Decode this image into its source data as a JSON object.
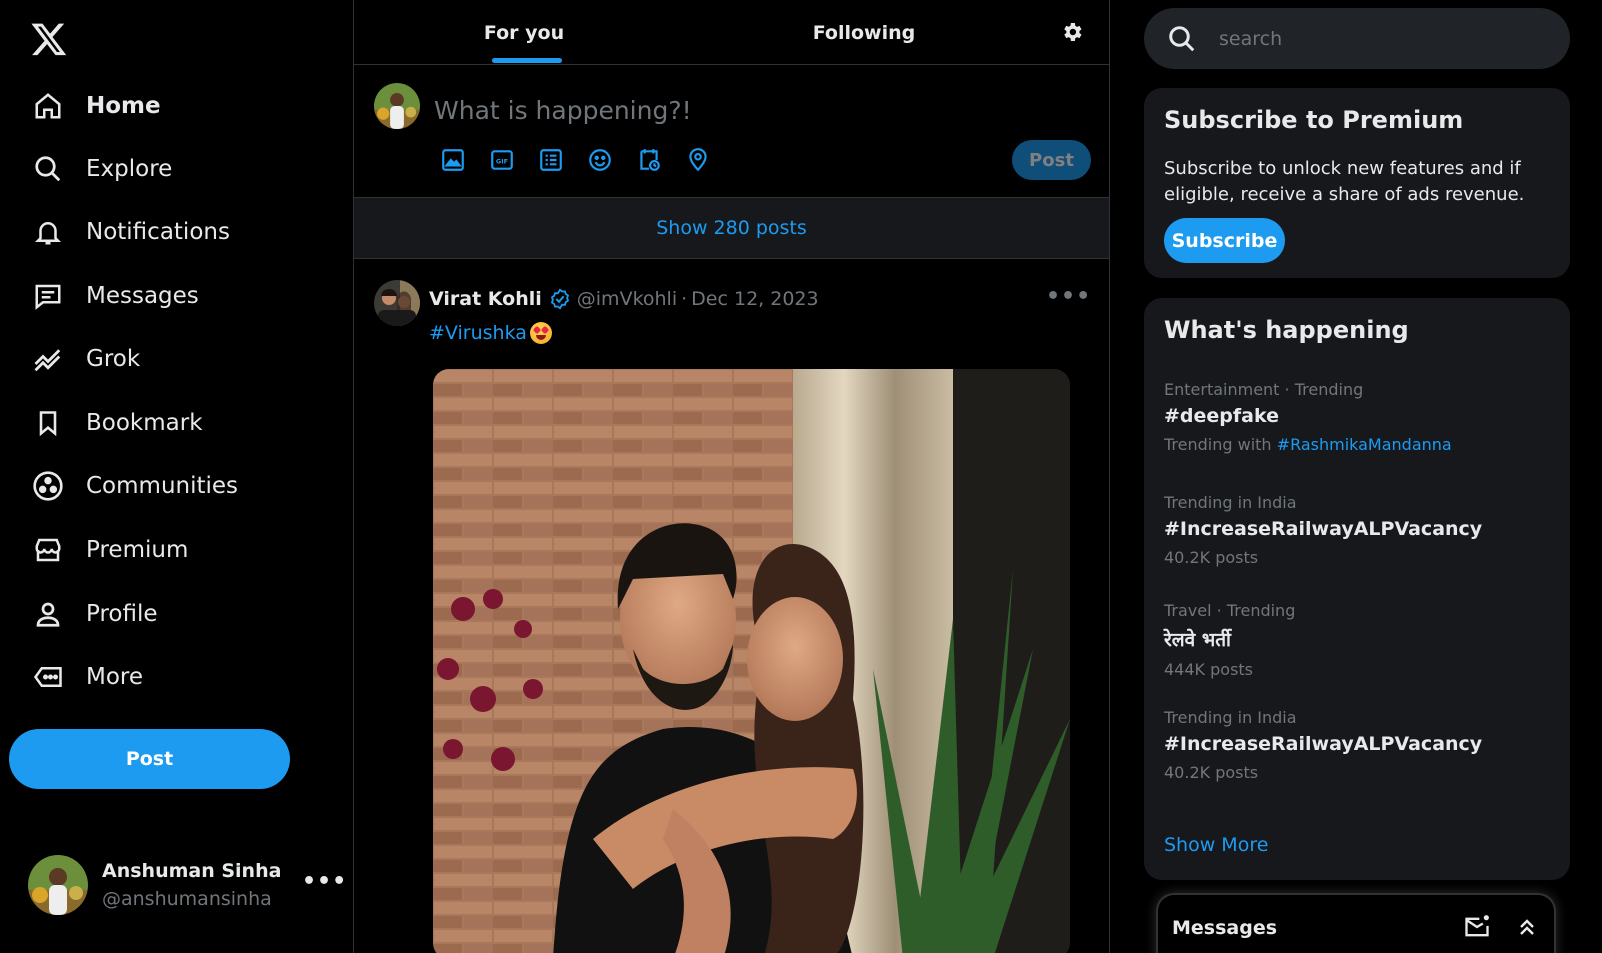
{
  "sidebar": {
    "logo_icon": "x-logo-icon",
    "items": [
      {
        "label": "Home",
        "icon": "home-icon",
        "active": true
      },
      {
        "label": "Explore",
        "icon": "search-icon"
      },
      {
        "label": "Notifications",
        "icon": "bell-icon"
      },
      {
        "label": "Messages",
        "icon": "message-icon"
      },
      {
        "label": "Grok",
        "icon": "grok-icon"
      },
      {
        "label": "Bookmark",
        "icon": "bookmark-icon"
      },
      {
        "label": "Communities",
        "icon": "communities-icon"
      },
      {
        "label": "Premium",
        "icon": "premium-icon"
      },
      {
        "label": "Profile",
        "icon": "profile-icon"
      },
      {
        "label": "More",
        "icon": "more-icon"
      }
    ],
    "post_label": "Post",
    "account": {
      "name": "Anshuman Sinha",
      "handle": "@anshumansinha",
      "more": "•••"
    }
  },
  "feed": {
    "tabs": [
      {
        "label": "For you",
        "active": true
      },
      {
        "label": "Following"
      }
    ],
    "composer": {
      "placeholder": "What is happening?!",
      "tools": [
        "image-icon",
        "gif-icon",
        "poll-icon",
        "emoji-icon",
        "schedule-icon",
        "location-icon"
      ],
      "post_label": "Post"
    },
    "show_posts": "Show 280 posts",
    "tweet": {
      "name": "Virat Kohli",
      "handle": "@imVkohli",
      "separator": "·",
      "date": "Dec 12, 2023",
      "hashtag": "#Virushka",
      "more": "•••"
    }
  },
  "right": {
    "search_placeholder": "search",
    "premium": {
      "title": "Subscribe to Premium",
      "text": "Subscribe to unlock new features and if eligible, receive a share of ads revenue.",
      "button": "Subscribe"
    },
    "happening": {
      "title": "What's happening",
      "trends": [
        {
          "meta": "Entertainment · Trending",
          "tag": "#deepfake",
          "sub_prefix": "Trending with ",
          "sub_link": "#RashmikaMandanna"
        },
        {
          "meta": "Trending in India",
          "tag": "#IncreaseRailwayALPVacancy",
          "sub": "40.2K posts"
        },
        {
          "meta": "Travel · Trending",
          "tag": "रेलवे भर्ती",
          "sub": "444K posts"
        },
        {
          "meta": "Trending in India",
          "tag": "#IncreaseRailwayALPVacancy",
          "sub": "40.2K posts"
        }
      ],
      "show_more": "Show More"
    },
    "messages": {
      "title": "Messages"
    }
  },
  "colors": {
    "accent": "#1d9bf0",
    "background": "#000000",
    "card": "#16181c",
    "muted": "#71767b"
  }
}
